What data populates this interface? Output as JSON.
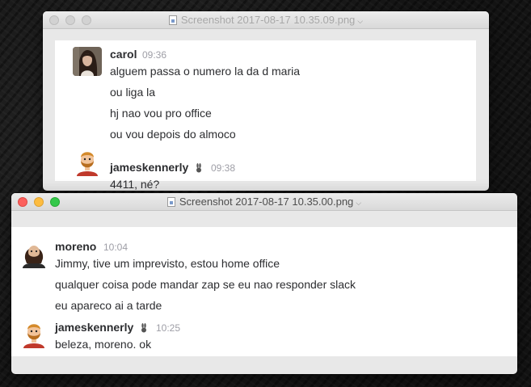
{
  "colors": {
    "close": "#fc605c",
    "minimize": "#fdbc40",
    "zoom": "#34c84a",
    "username": "#2c2d30",
    "timestamp": "#9e9ea6"
  },
  "window_back": {
    "title": "Screenshot 2017-08-17 10.35.09.png",
    "file_icon": "png-file-icon",
    "messages": [
      {
        "user": "carol",
        "time": "09:36",
        "avatar": "woman-avatar",
        "lines": [
          "alguem passa o numero la da d maria",
          "ou liga la",
          "hj nao vou pro office",
          "ou vou depois do almoco"
        ]
      },
      {
        "user": "jameskennerly",
        "badge": "rabbit-badge",
        "time": "09:38",
        "avatar": "cartoon-man-avatar",
        "lines": [
          "4411, né?"
        ]
      }
    ]
  },
  "window_front": {
    "title": "Screenshot 2017-08-17 10.35.00.png",
    "file_icon": "png-file-icon",
    "messages": [
      {
        "user": "moreno",
        "time": "10:04",
        "avatar": "bearded-man-avatar",
        "lines": [
          "Jimmy, tive um imprevisto, estou home office",
          "qualquer coisa pode mandar zap se eu nao responder slack",
          "eu apareco ai a tarde"
        ]
      },
      {
        "user": "jameskennerly",
        "badge": "rabbit-badge",
        "time": "10:25",
        "avatar": "cartoon-man-avatar",
        "lines": [
          "beleza, moreno. ok"
        ]
      }
    ]
  }
}
